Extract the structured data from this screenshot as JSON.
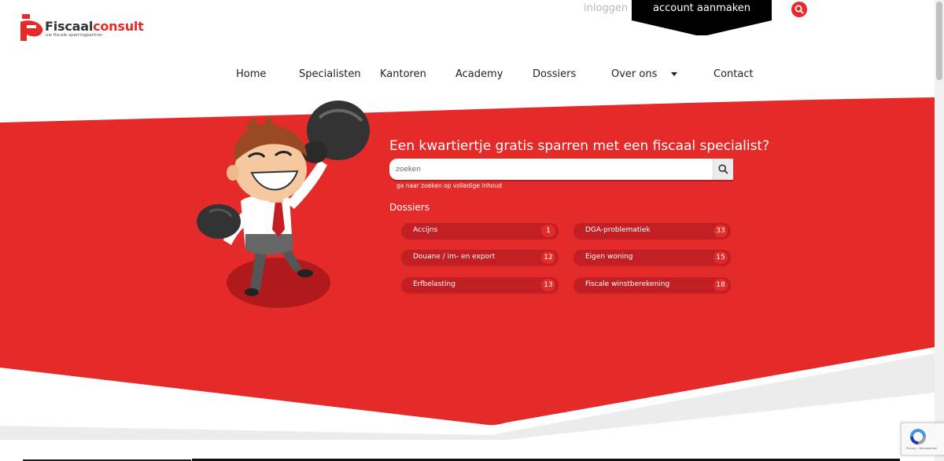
{
  "header": {
    "logo_name": "Fiscaal",
    "logo_name_accent": "consult",
    "logo_tagline": "uw fiscale sparringpartner",
    "login_label": "inloggen",
    "account_label": "account aanmaken"
  },
  "nav": {
    "items": [
      "Home",
      "Specialisten",
      "Kantoren",
      "Academy",
      "Dossiers",
      "Over ons",
      "Contact"
    ]
  },
  "hero": {
    "title": "Een kwartiertje gratis sparren met een fiscaal specialist?",
    "search_placeholder": "zoeken",
    "fulltext_link": "ga naar zoeken op volledige inhoud",
    "dossiers_heading": "Dossiers",
    "dossiers": [
      {
        "label": "Accijns",
        "count": "1"
      },
      {
        "label": "DGA-problematiek",
        "count": "33"
      },
      {
        "label": "Douane / im- en export",
        "count": "12"
      },
      {
        "label": "Eigen woning",
        "count": "15"
      },
      {
        "label": "Erfbelasting",
        "count": "13"
      },
      {
        "label": "Fiscale winstberekening",
        "count": "18"
      }
    ]
  },
  "recaptcha": {
    "text": "Privacy - Voorwaarden"
  },
  "colors": {
    "brand_red": "#e52a2a",
    "pill_red": "#c21f24",
    "black": "#000000"
  }
}
